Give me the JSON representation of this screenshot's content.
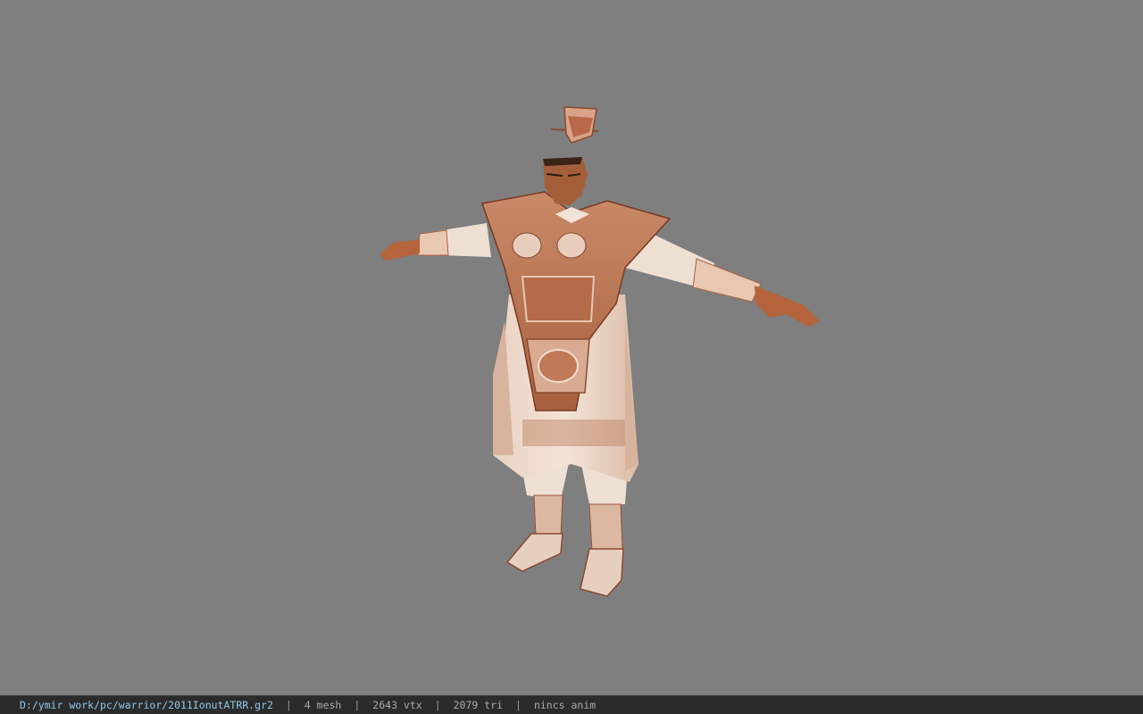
{
  "viewport": {
    "background": "#7f7f7f",
    "subject": "model-preview"
  },
  "status_bar": {
    "file_path": "D:/ymir work/pc/warrior/2011IonutATRR.gr2",
    "separator": "|",
    "mesh_count": "4 mesh",
    "vertex_count": "2643 vtx",
    "triangle_count": "2079 tri",
    "anim_status": "nincs anim",
    "path_color": "#8fc6e8",
    "text_color": "#a9a9a9"
  }
}
